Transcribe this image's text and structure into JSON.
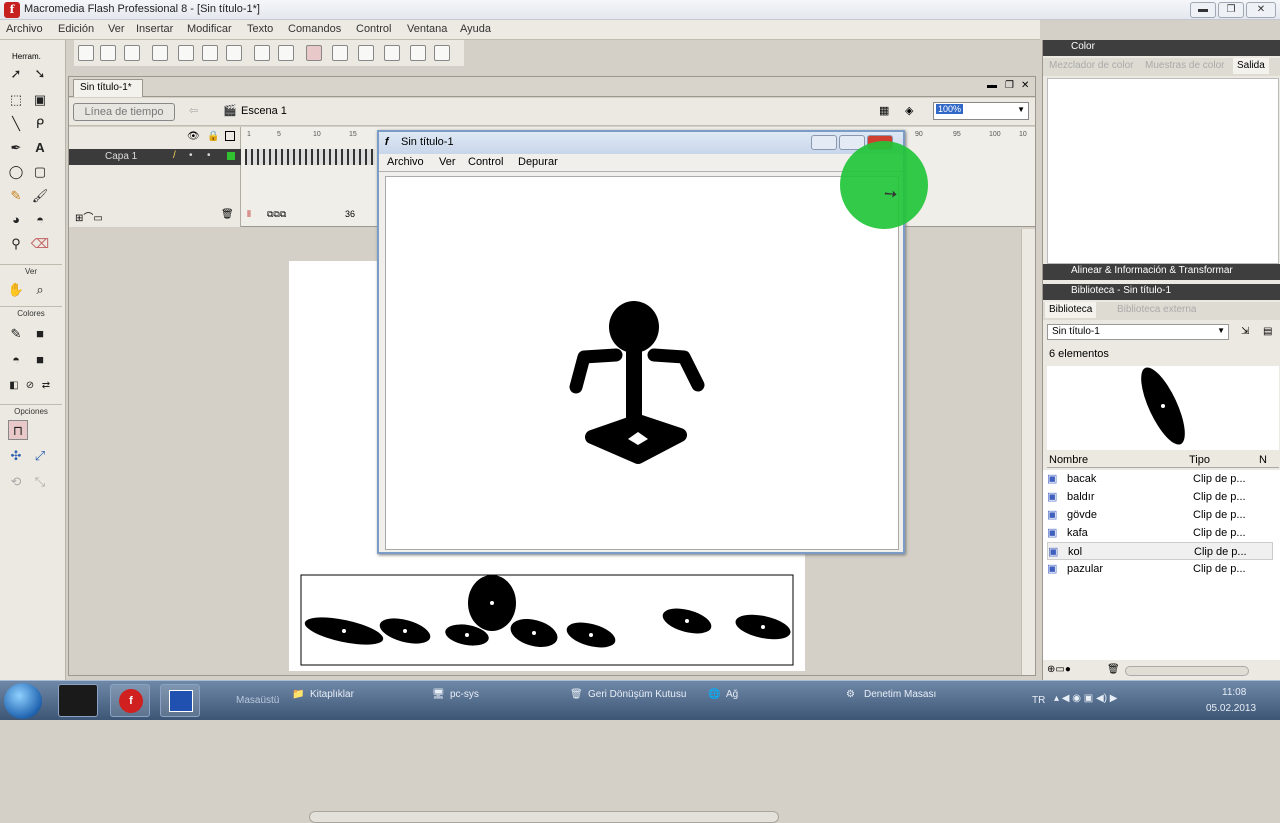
{
  "window": {
    "title": "Macromedia Flash Professional 8 - [Sin título-1*]"
  },
  "menu": [
    "Archivo",
    "Edición",
    "Ver",
    "Insertar",
    "Modificar",
    "Texto",
    "Comandos",
    "Control",
    "Ventana",
    "Ayuda"
  ],
  "tools": {
    "header": "Herram.",
    "view": "Ver",
    "colors": "Colores",
    "options": "Opciones"
  },
  "document": {
    "tab": "Sin título-1*",
    "timeline_button": "Línea de tiempo",
    "scene": "Escena 1",
    "zoom": "100%",
    "layer": "Capa 1",
    "ruler": [
      "1",
      "5",
      "10",
      "15",
      "90",
      "95",
      "100",
      "10"
    ],
    "frame_number": "36"
  },
  "player": {
    "title": "Sin título-1",
    "menu": [
      "Archivo",
      "Ver",
      "Control",
      "Depurar"
    ]
  },
  "panels": {
    "color": {
      "title": "Color",
      "tabs": [
        "Mezclador de color",
        "Muestras de color",
        "Salida"
      ]
    },
    "align": {
      "title": "Alinear & Información & Transformar"
    },
    "library": {
      "title": "Biblioteca - Sin título-1",
      "tabs": [
        "Biblioteca",
        "Biblioteca externa"
      ],
      "selector": "Sin título-1",
      "count": "6 elementos",
      "columns": [
        "Nombre",
        "Tipo",
        "N"
      ],
      "items": [
        {
          "name": "bacak",
          "type": "Clip de p..."
        },
        {
          "name": "baldır",
          "type": "Clip de p..."
        },
        {
          "name": "gövde",
          "type": "Clip de p..."
        },
        {
          "name": "kafa",
          "type": "Clip de p..."
        },
        {
          "name": "kol",
          "type": "Clip de p..."
        },
        {
          "name": "pazular",
          "type": "Clip de p..."
        }
      ]
    }
  },
  "taskbar": {
    "desktop": "Masaüstü",
    "items": [
      "Kitaplıklar",
      "pc-sys",
      "Geri Dönüşüm Kutusu",
      "Ağ",
      "Denetim Masası"
    ],
    "lang": "TR",
    "time": "11:08",
    "date": "05.02.2013"
  },
  "colors": {
    "cursor_highlight": "#22c43a",
    "accent": "#c62020"
  }
}
